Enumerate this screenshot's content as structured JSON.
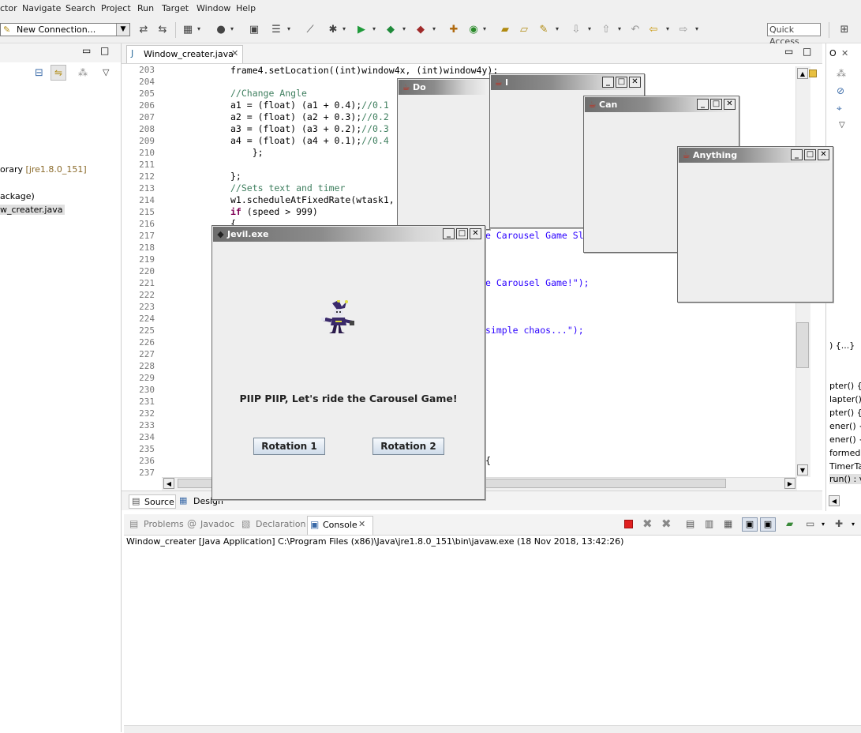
{
  "menubar": {
    "items": [
      "ctor",
      "Navigate",
      "Search",
      "Project",
      "Run",
      "Target",
      "Window",
      "Help"
    ]
  },
  "toolbar": {
    "connection": "New Connection...",
    "quick_access_placeholder": "Quick Access"
  },
  "left_panel": {
    "items": [
      {
        "label": "orary ",
        "detail": "[jre1.8.0_151]"
      },
      {
        "label": "ackage)"
      },
      {
        "label": "w_creater.java"
      }
    ]
  },
  "editor": {
    "tab_label": "Window_creater.java",
    "line_numbers": [
      "203",
      "204",
      "205",
      "206",
      "207",
      "208",
      "209",
      "210",
      "211",
      "212",
      "213",
      "214",
      "215",
      "216",
      "217",
      "218",
      "219",
      "220",
      "221",
      "222",
      "223",
      "224",
      "225",
      "226",
      "227",
      "228",
      "229",
      "230",
      "231",
      "232",
      "233",
      "234",
      "235",
      "236",
      "237"
    ],
    "code": {
      "l203": "frame4.setLocation((int)window4x, (int)window4y);",
      "l205": "//Change Angle",
      "l206a": "a1 = (float) (a1 + 0.4);",
      "l206b": "//0.1",
      "l207a": "a2 = (float) (a2 + 0.3);",
      "l207b": "//0.2",
      "l208a": "a3 = (float) (a3 + 0.2);",
      "l208b": "//0.3",
      "l209a": "a4 = (float) (a4 + 0.1);",
      "l209b": "//0.4",
      "l210": "    };",
      "l212": "};",
      "l213": "//Sets text and timer",
      "l214": "w1.scheduleAtFixedRate(wtask1,",
      "l215a": "if",
      "l215b": " (speed > 999)",
      "l216": "{",
      "l217": "e Carousel Game Sl",
      "l221": "e Carousel Game!\");",
      "l225": "simple chaos...\");",
      "l236": "{"
    },
    "source_tab": "Source",
    "design_tab": "Design"
  },
  "right_panel": {
    "items": [
      ") {...}",
      "pter() {...",
      "lapter() {",
      "pter() {...",
      "ener() {...",
      "ener() {...",
      "formed(A",
      "TimerTas",
      "run() : v"
    ]
  },
  "console": {
    "tabs": [
      "Problems",
      "Javadoc",
      "Declaration",
      "Console"
    ],
    "status": "Window_creater [Java Application] C:\\Program Files (x86)\\Java\\jre1.8.0_151\\bin\\javaw.exe (18 Nov 2018, 13:42:26)"
  },
  "windows": {
    "main": {
      "title": "Jevil.exe",
      "message": "PIIP PIIP, Let's ride the Carousel Game!",
      "button1": "Rotation 1",
      "button2": "Rotation 2"
    },
    "do": {
      "title": "Do"
    },
    "i": {
      "title": "I"
    },
    "can": {
      "title": "Can"
    },
    "anything": {
      "title": "Anything"
    }
  },
  "colors": {
    "comment": "#3f7f5f",
    "string": "#2a00ff",
    "keyword": "#7f0055",
    "stop_button": "#e02020"
  }
}
